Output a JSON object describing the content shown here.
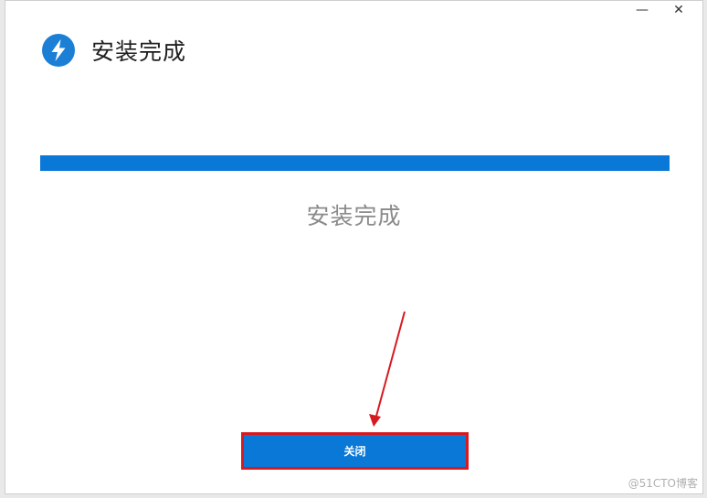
{
  "window": {
    "controls": {
      "minimize": "—",
      "close": "✕"
    }
  },
  "header": {
    "icon": "lightning-bolt-icon",
    "title": "安装完成"
  },
  "progress": {
    "value_percent": 100,
    "color": "#0a78d7"
  },
  "status": {
    "text": "安装完成"
  },
  "actions": {
    "close_label": "关闭"
  },
  "watermark": "@51CTO博客"
}
